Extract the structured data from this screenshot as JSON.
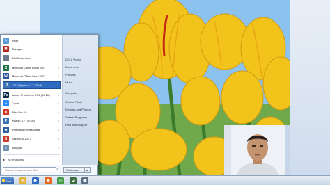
{
  "start_menu": {
    "programs": [
      {
        "label": "Paint",
        "icon": "paint-icon",
        "color": "#5a9bd8",
        "glyph": "✎",
        "submenu": false
      },
      {
        "label": "Manager",
        "icon": "manager-icon",
        "color": "#b3261e",
        "glyph": "M",
        "submenu": false
      },
      {
        "label": "Distributor-new",
        "icon": "distributor-icon",
        "color": "#6b7b8c",
        "glyph": "▪",
        "submenu": false
      },
      {
        "label": "Microsoft Office Excel 2007",
        "icon": "excel-icon",
        "color": "#1e7145",
        "glyph": "X",
        "submenu": true
      },
      {
        "label": "Microsoft Office Word 2007",
        "icon": "word-icon",
        "color": "#2b579a",
        "glyph": "W",
        "submenu": true
      },
      {
        "label": "IDLE (Python 3.7 32-bit)",
        "icon": "python-idle-icon",
        "color": "#3b74b0",
        "glyph": "P",
        "submenu": true
      },
      {
        "label": "Adobe Photoshop CS6 (64 Bit)",
        "icon": "photoshop-icon",
        "color": "#0b2a4a",
        "glyph": "Ps",
        "submenu": true
      },
      {
        "label": "Zoom",
        "icon": "zoom-icon",
        "color": "#2d8cff",
        "glyph": "●",
        "submenu": true
      },
      {
        "label": "Nitro Pro 10",
        "icon": "nitro-icon",
        "color": "#d23a2a",
        "glyph": "N",
        "submenu": true
      },
      {
        "label": "Python 3.7 (32-bit)",
        "icon": "python-icon",
        "color": "#3b74b0",
        "glyph": "P",
        "submenu": true
      },
      {
        "label": "Proteus 8 Professional",
        "icon": "proteus-icon",
        "color": "#2c5fa5",
        "glyph": "◆",
        "submenu": true
      },
      {
        "label": "SketchUp 2017",
        "icon": "sketchup-icon",
        "color": "#c8392b",
        "glyph": "S",
        "submenu": true
      },
      {
        "label": "Notepad",
        "icon": "notepad-icon",
        "color": "#6f8fb0",
        "glyph": "≡",
        "submenu": true
      }
    ],
    "all_programs_label": "All Programs",
    "search_placeholder": "Search programs and files",
    "places": [
      "DELL Vostro",
      "Documents",
      "Pictures",
      "Music",
      "Computer",
      "Control Panel",
      "Devices and Printers",
      "Default Programs",
      "Help and Support"
    ],
    "shutdown_label": "Shut down"
  },
  "taskbar": {
    "start_label": "Start",
    "icons": [
      {
        "name": "taskbar-explorer-icon",
        "color": "#e2b33a",
        "glyph": "▤"
      },
      {
        "name": "taskbar-media-icon",
        "color": "#2f6cc1",
        "glyph": "▶"
      },
      {
        "name": "taskbar-firefox-icon",
        "color": "#e76a1c",
        "glyph": "◉"
      },
      {
        "name": "taskbar-chrome-icon",
        "color": "#3f9b42",
        "glyph": "◎"
      },
      {
        "name": "taskbar-app-icon",
        "color": "#3a6d3f",
        "glyph": "◢"
      },
      {
        "name": "taskbar-window-icon",
        "color": "#5b6f86",
        "glyph": "▣"
      }
    ]
  },
  "colors": {
    "selection": "#2f6cc1",
    "tulip": "#f4c21c",
    "sky": "#8ec1ec"
  }
}
